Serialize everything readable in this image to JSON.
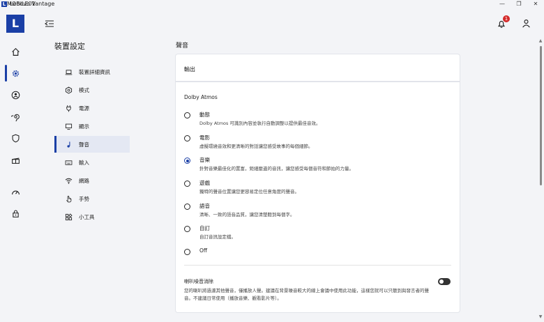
{
  "window": {
    "title": "Lenovo Vantage",
    "logo_letter": "L",
    "watermark": "MOBILE01"
  },
  "notifications": {
    "count": "1"
  },
  "settings_nav": {
    "title": "裝置設定",
    "items": [
      {
        "label": "裝置詳細資訊",
        "icon": "laptop-icon"
      },
      {
        "label": "模式",
        "icon": "hexagon-icon"
      },
      {
        "label": "電源",
        "icon": "plug-icon"
      },
      {
        "label": "顯示",
        "icon": "monitor-icon"
      },
      {
        "label": "聲音",
        "icon": "music-note-icon",
        "active": true
      },
      {
        "label": "輸入",
        "icon": "keyboard-icon"
      },
      {
        "label": "網路",
        "icon": "wifi-icon"
      },
      {
        "label": "手勢",
        "icon": "hand-icon"
      },
      {
        "label": "小工具",
        "icon": "apps-icon"
      }
    ]
  },
  "main": {
    "section_title": "聲音",
    "output_header": "輸出",
    "dolby": {
      "title": "Dolby Atmos",
      "options": [
        {
          "label": "動態",
          "desc": "Dolby Atmos 可識別內容並執行自動調整以提供最佳音效。"
        },
        {
          "label": "電影",
          "desc": "虛擬環繞音效和更清晰的對話讓您感受故事的每個細節。"
        },
        {
          "label": "音樂",
          "desc": "針對音樂最佳化的置富，鉅細靡遺的音訊，讓您感受每個音符和節拍的力量。",
          "selected": true
        },
        {
          "label": "遊戲",
          "desc": "獨特的聲音位置讓您更容易定位任意角度的聲音。"
        },
        {
          "label": "語音",
          "desc": "清晰、一致的語音品質，讓您清楚聽到每個字。"
        },
        {
          "label": "自訂",
          "desc": "自訂音訊設定檔。"
        },
        {
          "label": "Off",
          "desc": ""
        }
      ]
    },
    "noise_cancel": {
      "title": "喇叭噪音消除",
      "desc": "您的喇叭將過濾其他聲音，僅播放人聲。建議在背景噪音較大的線上會議中使用此功能，這樣您就可以只聽到與發言者的聲音。不建議日常使用（播放音樂、觀看影片等）。",
      "enabled": false
    }
  },
  "colors": {
    "accent": "#1a3fa6",
    "badge": "#d42a2a",
    "background": "#f3f4f7"
  }
}
